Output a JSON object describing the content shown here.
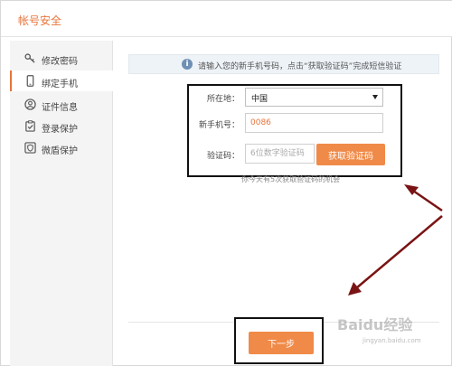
{
  "window": {
    "title": "帐号安全"
  },
  "sidebar": {
    "items": [
      {
        "label": "修改密码",
        "icon": "key-icon"
      },
      {
        "label": "绑定手机",
        "icon": "phone-icon",
        "active": true
      },
      {
        "label": "证件信息",
        "icon": "user-icon"
      },
      {
        "label": "登录保护",
        "icon": "clipboard-check-icon"
      },
      {
        "label": "微盾保护",
        "icon": "shield-icon"
      }
    ]
  },
  "notice": {
    "text": "请输入您的新手机号码，点击“获取验证码”完成短信验证"
  },
  "form": {
    "location_label": "所在地：",
    "location_value": "中国",
    "phone_label": "新手机号：",
    "phone_value": "0086",
    "code_label": "验证码：",
    "code_placeholder": "6位数字验证码",
    "get_code_label": "获取验证码",
    "hint": "你今天有5次获取验证码的机会"
  },
  "footer": {
    "next_label": "下一步"
  },
  "watermark": {
    "text": "Baidu经验",
    "url": "jingyan.baidu.com"
  },
  "colors": {
    "accent": "#f08a48",
    "title": "#e8743b",
    "annotation": "#111111",
    "arrow": "#7a1414"
  }
}
